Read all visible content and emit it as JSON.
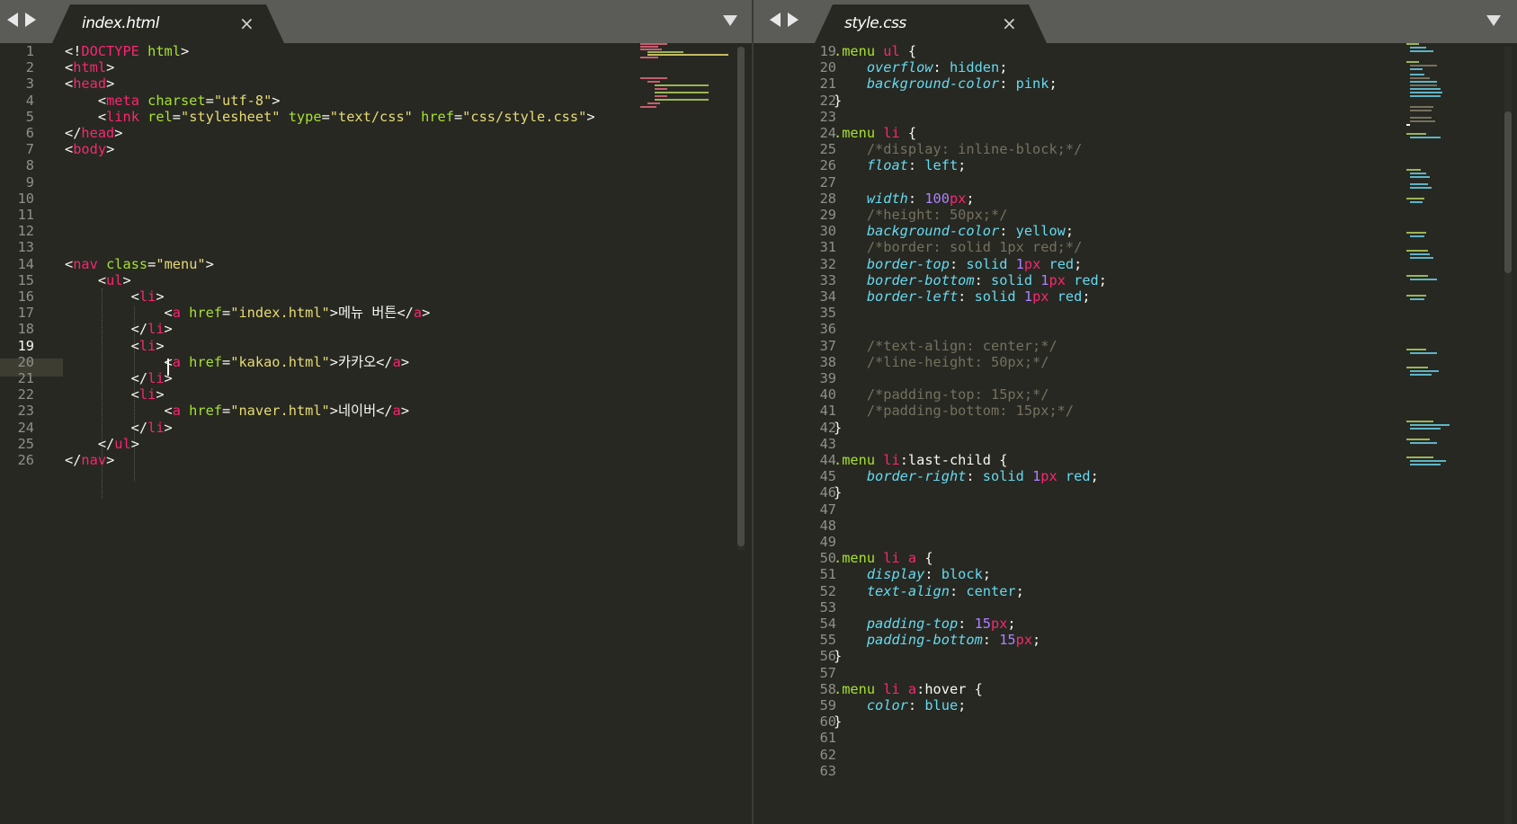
{
  "left_pane": {
    "tab": {
      "title": "index.html",
      "close_glyph": "×",
      "active": true
    },
    "current_line": 19,
    "lines": [
      {
        "n": "1",
        "tokens": [
          [
            "p",
            "<!"
          ],
          [
            "t",
            "DOCTYPE"
          ],
          [
            "p",
            " "
          ],
          [
            "a",
            "html"
          ],
          [
            "p",
            ">"
          ]
        ]
      },
      {
        "n": "2",
        "tokens": [
          [
            "p",
            "<"
          ],
          [
            "t",
            "html"
          ],
          [
            "p",
            ">"
          ]
        ]
      },
      {
        "n": "3",
        "tokens": [
          [
            "p",
            "<"
          ],
          [
            "t",
            "head"
          ],
          [
            "p",
            ">"
          ]
        ]
      },
      {
        "n": "4",
        "tokens": [
          [
            "p",
            "    <"
          ],
          [
            "t",
            "meta"
          ],
          [
            "p",
            " "
          ],
          [
            "a",
            "charset"
          ],
          [
            "p",
            "="
          ],
          [
            "s",
            "\"utf-8\""
          ],
          [
            "p",
            ">"
          ]
        ]
      },
      {
        "n": "5",
        "tokens": [
          [
            "p",
            "    <"
          ],
          [
            "t",
            "link"
          ],
          [
            "p",
            " "
          ],
          [
            "a",
            "rel"
          ],
          [
            "p",
            "="
          ],
          [
            "s",
            "\"stylesheet\""
          ],
          [
            "p",
            " "
          ],
          [
            "a",
            "type"
          ],
          [
            "p",
            "="
          ],
          [
            "s",
            "\"text/css\""
          ],
          [
            "p",
            " "
          ],
          [
            "a",
            "href"
          ],
          [
            "p",
            "="
          ],
          [
            "s",
            "\"css/style.css\""
          ],
          [
            "p",
            ">"
          ]
        ]
      },
      {
        "n": "6",
        "tokens": [
          [
            "p",
            "</"
          ],
          [
            "t",
            "head"
          ],
          [
            "p",
            ">"
          ]
        ]
      },
      {
        "n": "7",
        "tokens": [
          [
            "p",
            "<"
          ],
          [
            "t",
            "body"
          ],
          [
            "p",
            ">"
          ]
        ]
      },
      {
        "n": "8",
        "tokens": []
      },
      {
        "n": "9",
        "tokens": []
      },
      {
        "n": "10",
        "tokens": []
      },
      {
        "n": "11",
        "tokens": []
      },
      {
        "n": "12",
        "tokens": []
      },
      {
        "n": "13",
        "tokens": []
      },
      {
        "n": "14",
        "tokens": [
          [
            "p",
            "<"
          ],
          [
            "t",
            "nav"
          ],
          [
            "p",
            " "
          ],
          [
            "a",
            "class"
          ],
          [
            "p",
            "="
          ],
          [
            "s",
            "\"menu\""
          ],
          [
            "p",
            ">"
          ]
        ]
      },
      {
        "n": "15",
        "tokens": [
          [
            "p",
            "    <"
          ],
          [
            "t",
            "ul"
          ],
          [
            "p",
            ">"
          ]
        ]
      },
      {
        "n": "16",
        "tokens": [
          [
            "p",
            "        <"
          ],
          [
            "t",
            "li"
          ],
          [
            "p",
            ">"
          ]
        ]
      },
      {
        "n": "17",
        "tokens": [
          [
            "p",
            "            <"
          ],
          [
            "t",
            "a"
          ],
          [
            "p",
            " "
          ],
          [
            "a",
            "href"
          ],
          [
            "p",
            "="
          ],
          [
            "s",
            "\"index.html\""
          ],
          [
            "p",
            ">메뉴 버튼</"
          ],
          [
            "t",
            "a"
          ],
          [
            "p",
            ">"
          ]
        ]
      },
      {
        "n": "18",
        "tokens": [
          [
            "p",
            "        </"
          ],
          [
            "t",
            "li"
          ],
          [
            "p",
            ">"
          ]
        ]
      },
      {
        "n": "19",
        "tokens": [
          [
            "p",
            "        <"
          ],
          [
            "t",
            "li"
          ],
          [
            "p",
            ">"
          ]
        ]
      },
      {
        "n": "20",
        "tokens": [
          [
            "p",
            "            <"
          ],
          [
            "t",
            "a"
          ],
          [
            "p",
            " "
          ],
          [
            "a",
            "href"
          ],
          [
            "p",
            "="
          ],
          [
            "s",
            "\"kakao.html\""
          ],
          [
            "p",
            ">카카오</"
          ],
          [
            "t",
            "a"
          ],
          [
            "p",
            ">"
          ]
        ]
      },
      {
        "n": "21",
        "tokens": [
          [
            "p",
            "        </"
          ],
          [
            "t",
            "li"
          ],
          [
            "p",
            ">"
          ]
        ]
      },
      {
        "n": "22",
        "tokens": [
          [
            "p",
            "        <"
          ],
          [
            "t",
            "li"
          ],
          [
            "p",
            ">"
          ]
        ]
      },
      {
        "n": "23",
        "tokens": [
          [
            "p",
            "            <"
          ],
          [
            "t",
            "a"
          ],
          [
            "p",
            " "
          ],
          [
            "a",
            "href"
          ],
          [
            "p",
            "="
          ],
          [
            "s",
            "\"naver.html\""
          ],
          [
            "p",
            ">네이버</"
          ],
          [
            "t",
            "a"
          ],
          [
            "p",
            ">"
          ]
        ]
      },
      {
        "n": "24",
        "tokens": [
          [
            "p",
            "        </"
          ],
          [
            "t",
            "li"
          ],
          [
            "p",
            ">"
          ]
        ]
      },
      {
        "n": "25",
        "tokens": [
          [
            "p",
            "    </"
          ],
          [
            "t",
            "ul"
          ],
          [
            "p",
            ">"
          ]
        ]
      },
      {
        "n": "26",
        "tokens": [
          [
            "p",
            "</"
          ],
          [
            "t",
            "nav"
          ],
          [
            "p",
            ">"
          ]
        ]
      }
    ]
  },
  "right_pane": {
    "tab": {
      "title": "style.css",
      "close_glyph": "×",
      "active": true
    },
    "lines": [
      {
        "n": "19",
        "tokens": [
          [
            "c",
            ".menu"
          ],
          [
            "p",
            " "
          ],
          [
            "t",
            "ul"
          ],
          [
            "p",
            " {"
          ]
        ]
      },
      {
        "n": "20",
        "tokens": [
          [
            "p",
            "    "
          ],
          [
            "k",
            "overflow"
          ],
          [
            "p",
            ": "
          ],
          [
            "v",
            "hidden"
          ],
          [
            "p",
            ";"
          ]
        ]
      },
      {
        "n": "21",
        "tokens": [
          [
            "p",
            "    "
          ],
          [
            "k",
            "background-color"
          ],
          [
            "p",
            ": "
          ],
          [
            "v",
            "pink"
          ],
          [
            "p",
            ";"
          ]
        ]
      },
      {
        "n": "22",
        "tokens": [
          [
            "p",
            "}"
          ]
        ]
      },
      {
        "n": "23",
        "tokens": []
      },
      {
        "n": "24",
        "tokens": [
          [
            "c",
            ".menu"
          ],
          [
            "p",
            " "
          ],
          [
            "t",
            "li"
          ],
          [
            "p",
            " {"
          ]
        ]
      },
      {
        "n": "25",
        "tokens": [
          [
            "p",
            "    "
          ],
          [
            "m",
            "/*display: inline-block;*/"
          ]
        ]
      },
      {
        "n": "26",
        "tokens": [
          [
            "p",
            "    "
          ],
          [
            "k",
            "float"
          ],
          [
            "p",
            ": "
          ],
          [
            "v",
            "left"
          ],
          [
            "p",
            ";"
          ]
        ]
      },
      {
        "n": "27",
        "tokens": []
      },
      {
        "n": "28",
        "tokens": [
          [
            "p",
            "    "
          ],
          [
            "k",
            "width"
          ],
          [
            "p",
            ": "
          ],
          [
            "u",
            "100"
          ],
          [
            "t",
            "px"
          ],
          [
            "p",
            ";"
          ]
        ]
      },
      {
        "n": "29",
        "tokens": [
          [
            "p",
            "    "
          ],
          [
            "m",
            "/*height: 50px;*/"
          ]
        ]
      },
      {
        "n": "30",
        "tokens": [
          [
            "p",
            "    "
          ],
          [
            "k",
            "background-color"
          ],
          [
            "p",
            ": "
          ],
          [
            "v",
            "yellow"
          ],
          [
            "p",
            ";"
          ]
        ]
      },
      {
        "n": "31",
        "tokens": [
          [
            "p",
            "    "
          ],
          [
            "m",
            "/*border: solid 1px red;*/"
          ]
        ]
      },
      {
        "n": "32",
        "tokens": [
          [
            "p",
            "    "
          ],
          [
            "k",
            "border-top"
          ],
          [
            "p",
            ": "
          ],
          [
            "v",
            "solid"
          ],
          [
            "p",
            " "
          ],
          [
            "u",
            "1"
          ],
          [
            "t",
            "px"
          ],
          [
            "p",
            " "
          ],
          [
            "v",
            "red"
          ],
          [
            "p",
            ";"
          ]
        ]
      },
      {
        "n": "33",
        "tokens": [
          [
            "p",
            "    "
          ],
          [
            "k",
            "border-bottom"
          ],
          [
            "p",
            ": "
          ],
          [
            "v",
            "solid"
          ],
          [
            "p",
            " "
          ],
          [
            "u",
            "1"
          ],
          [
            "t",
            "px"
          ],
          [
            "p",
            " "
          ],
          [
            "v",
            "red"
          ],
          [
            "p",
            ";"
          ]
        ]
      },
      {
        "n": "34",
        "tokens": [
          [
            "p",
            "    "
          ],
          [
            "k",
            "border-left"
          ],
          [
            "p",
            ": "
          ],
          [
            "v",
            "solid"
          ],
          [
            "p",
            " "
          ],
          [
            "u",
            "1"
          ],
          [
            "t",
            "px"
          ],
          [
            "p",
            " "
          ],
          [
            "v",
            "red"
          ],
          [
            "p",
            ";"
          ]
        ]
      },
      {
        "n": "35",
        "tokens": []
      },
      {
        "n": "36",
        "tokens": []
      },
      {
        "n": "37",
        "tokens": [
          [
            "p",
            "    "
          ],
          [
            "m",
            "/*text-align: center;*/"
          ]
        ]
      },
      {
        "n": "38",
        "tokens": [
          [
            "p",
            "    "
          ],
          [
            "m",
            "/*line-height: 50px;*/"
          ]
        ]
      },
      {
        "n": "39",
        "tokens": []
      },
      {
        "n": "40",
        "tokens": [
          [
            "p",
            "    "
          ],
          [
            "m",
            "/*padding-top: 15px;*/"
          ]
        ]
      },
      {
        "n": "41",
        "tokens": [
          [
            "p",
            "    "
          ],
          [
            "m",
            "/*padding-bottom: 15px;*/"
          ]
        ]
      },
      {
        "n": "42",
        "tokens": [
          [
            "p",
            "}"
          ]
        ]
      },
      {
        "n": "43",
        "tokens": []
      },
      {
        "n": "44",
        "tokens": [
          [
            "c",
            ".menu"
          ],
          [
            "p",
            " "
          ],
          [
            "t",
            "li"
          ],
          [
            "p",
            ":last-child {"
          ]
        ]
      },
      {
        "n": "45",
        "tokens": [
          [
            "p",
            "    "
          ],
          [
            "k",
            "border-right"
          ],
          [
            "p",
            ": "
          ],
          [
            "v",
            "solid"
          ],
          [
            "p",
            " "
          ],
          [
            "u",
            "1"
          ],
          [
            "t",
            "px"
          ],
          [
            "p",
            " "
          ],
          [
            "v",
            "red"
          ],
          [
            "p",
            ";"
          ]
        ]
      },
      {
        "n": "46",
        "tokens": [
          [
            "p",
            "}"
          ]
        ]
      },
      {
        "n": "47",
        "tokens": []
      },
      {
        "n": "48",
        "tokens": []
      },
      {
        "n": "49",
        "tokens": []
      },
      {
        "n": "50",
        "tokens": [
          [
            "c",
            ".menu"
          ],
          [
            "p",
            " "
          ],
          [
            "t",
            "li"
          ],
          [
            "p",
            " "
          ],
          [
            "t",
            "a"
          ],
          [
            "p",
            " {"
          ]
        ]
      },
      {
        "n": "51",
        "tokens": [
          [
            "p",
            "    "
          ],
          [
            "k",
            "display"
          ],
          [
            "p",
            ": "
          ],
          [
            "v",
            "block"
          ],
          [
            "p",
            ";"
          ]
        ]
      },
      {
        "n": "52",
        "tokens": [
          [
            "p",
            "    "
          ],
          [
            "k",
            "text-align"
          ],
          [
            "p",
            ": "
          ],
          [
            "v",
            "center"
          ],
          [
            "p",
            ";"
          ]
        ]
      },
      {
        "n": "53",
        "tokens": []
      },
      {
        "n": "54",
        "tokens": [
          [
            "p",
            "    "
          ],
          [
            "k",
            "padding-top"
          ],
          [
            "p",
            ": "
          ],
          [
            "u",
            "15"
          ],
          [
            "t",
            "px"
          ],
          [
            "p",
            ";"
          ]
        ]
      },
      {
        "n": "55",
        "tokens": [
          [
            "p",
            "    "
          ],
          [
            "k",
            "padding-bottom"
          ],
          [
            "p",
            ": "
          ],
          [
            "u",
            "15"
          ],
          [
            "t",
            "px"
          ],
          [
            "p",
            ";"
          ]
        ]
      },
      {
        "n": "56",
        "tokens": [
          [
            "p",
            "}"
          ]
        ]
      },
      {
        "n": "57",
        "tokens": []
      },
      {
        "n": "58",
        "tokens": [
          [
            "c",
            ".menu"
          ],
          [
            "p",
            " "
          ],
          [
            "t",
            "li"
          ],
          [
            "p",
            " "
          ],
          [
            "t",
            "a"
          ],
          [
            "p",
            ":hover {"
          ]
        ]
      },
      {
        "n": "59",
        "tokens": [
          [
            "p",
            "    "
          ],
          [
            "k",
            "color"
          ],
          [
            "p",
            ": "
          ],
          [
            "v",
            "blue"
          ],
          [
            "p",
            ";"
          ]
        ]
      },
      {
        "n": "60",
        "tokens": [
          [
            "p",
            "}"
          ]
        ]
      },
      {
        "n": "61",
        "tokens": []
      },
      {
        "n": "62",
        "tokens": []
      },
      {
        "n": "63",
        "tokens": []
      }
    ]
  },
  "theme": {
    "background": "#272822",
    "tabbar": "#5b5c57",
    "tag": "#f92672",
    "attribute": "#a6e22e",
    "string": "#e6db74",
    "property": "#66d9ef",
    "number": "#ae81ff",
    "comment": "#75715e",
    "text": "#f8f8f2"
  },
  "icons": {
    "nav_prev": "triangle-left-icon",
    "nav_next": "triangle-right-icon",
    "close": "close-icon",
    "dropdown": "chevron-down-icon"
  }
}
